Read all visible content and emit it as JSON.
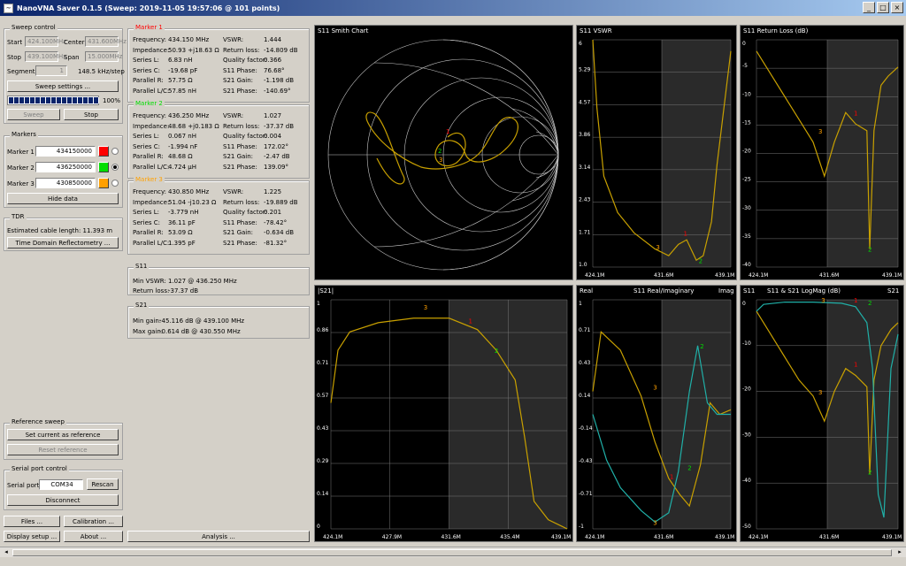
{
  "window": {
    "title": "NanoVNA Saver 0.1.5 (Sweep: 2019-11-05 19:57:06 @ 101 points)",
    "min": "_",
    "max": "□",
    "close": "×"
  },
  "sweep": {
    "title": "Sweep control",
    "start_label": "Start",
    "start_value": "424.100MHz",
    "center_label": "Center",
    "center_value": "431.600MHz",
    "stop_label": "Stop",
    "stop_value": "439.100MHz",
    "span_label": "Span",
    "span_value": "15.000MHz",
    "segments_label": "Segments",
    "segments_value": "1",
    "step_text": "148.5 kHz/step",
    "settings_btn": "Sweep settings ...",
    "progress_text": "100%",
    "progress": 1.0,
    "sweep_btn": "Sweep",
    "stop_btn": "Stop"
  },
  "markers": {
    "title": "Markers",
    "items": [
      {
        "label": "Marker 1",
        "value": "434150000",
        "color": "#ff0000"
      },
      {
        "label": "Marker 2",
        "value": "436250000",
        "color": "#00dd00"
      },
      {
        "label": "Marker 3",
        "value": "430850000",
        "color": "#ffa000"
      }
    ],
    "hide_btn": "Hide data"
  },
  "tdr": {
    "title": "TDR",
    "cable": "Estimated cable length: 11.393 m",
    "btn": "Time Domain Reflectometry ..."
  },
  "reference": {
    "title": "Reference sweep",
    "set_btn": "Set current as reference",
    "reset_btn": "Reset reference"
  },
  "serial": {
    "title": "Serial port control",
    "port_label": "Serial port",
    "port_value": "COM34",
    "rescan_btn": "Rescan",
    "disconnect_btn": "Disconnect"
  },
  "bottom": {
    "files": "Files ...",
    "calibration": "Calibration ...",
    "display": "Display setup ...",
    "about": "About ...",
    "analysis": "Analysis ..."
  },
  "m1": {
    "title": "Marker 1",
    "color": "#ff0000",
    "left": [
      [
        "Frequency:",
        "434.150 MHz"
      ],
      [
        "Impedance:",
        "50.93 +j18.63 Ω"
      ],
      [
        "Series L:",
        "6.83 nH"
      ],
      [
        "Series C:",
        "-19.68 pF"
      ],
      [
        "Parallel R:",
        "57.75 Ω"
      ],
      [
        "Parallel L/C:",
        "57.85 nH"
      ]
    ],
    "right": [
      [
        "VSWR:",
        "1.444"
      ],
      [
        "Return loss:",
        "-14.809 dB"
      ],
      [
        "Quality factor:",
        "0.366"
      ],
      [
        "S11 Phase:",
        "76.68°"
      ],
      [
        "S21 Gain:",
        "-1.198 dB"
      ],
      [
        "S21 Phase:",
        "-140.69°"
      ]
    ]
  },
  "m2": {
    "title": "Marker 2",
    "color": "#00dd00",
    "left": [
      [
        "Frequency:",
        "436.250 MHz"
      ],
      [
        "Impedance:",
        "48.68 +j0.183 Ω"
      ],
      [
        "Series L:",
        "0.067 nH"
      ],
      [
        "Series C:",
        "-1.994 nF"
      ],
      [
        "Parallel R:",
        "48.68 Ω"
      ],
      [
        "Parallel L/C:",
        "4.724 µH"
      ]
    ],
    "right": [
      [
        "VSWR:",
        "1.027"
      ],
      [
        "Return loss:",
        "-37.37 dB"
      ],
      [
        "Quality factor:",
        "0.004"
      ],
      [
        "S11 Phase:",
        "172.02°"
      ],
      [
        "S21 Gain:",
        "-2.47 dB"
      ],
      [
        "S21 Phase:",
        "139.09°"
      ]
    ]
  },
  "m3": {
    "title": "Marker 3",
    "color": "#ffa000",
    "left": [
      [
        "Frequency:",
        "430.850 MHz"
      ],
      [
        "Impedance:",
        "51.04 -j10.23 Ω"
      ],
      [
        "Series L:",
        "-3.779 nH"
      ],
      [
        "Series C:",
        "36.11 pF"
      ],
      [
        "Parallel R:",
        "53.09 Ω"
      ],
      [
        "Parallel L/C:",
        "1.395 pF"
      ]
    ],
    "right": [
      [
        "VSWR:",
        "1.225"
      ],
      [
        "Return loss:",
        "-19.889 dB"
      ],
      [
        "Quality factor:",
        "0.201"
      ],
      [
        "S11 Phase:",
        "-78.42°"
      ],
      [
        "S21 Gain:",
        "-0.634 dB"
      ],
      [
        "S21 Phase:",
        "-81.32°"
      ]
    ]
  },
  "s11box": {
    "title": "S11",
    "l1": "Min VSWR:",
    "v1": "1.027 @ 436.250 MHz",
    "l2": "Return loss:",
    "v2": "-37.37 dB"
  },
  "s21box": {
    "title": "S21",
    "l1": "Min gain:",
    "v1": "-45.116 dB @ 439.100 MHz",
    "l2": "Max gain:",
    "v2": "-0.614 dB @ 430.550 MHz"
  },
  "charts": {
    "smith": {
      "title": "S11 Smith Chart"
    },
    "vswr": {
      "title": "S11 VSWR",
      "yticks": [
        "6",
        "5.29",
        "4.57",
        "3.86",
        "3.14",
        "2.43",
        "1.71",
        "1.0"
      ],
      "xticks": [
        "424.1M",
        "431.6M",
        "439.1M"
      ]
    },
    "rl": {
      "title": "S11 Return Loss (dB)",
      "yticks": [
        "0",
        "-5",
        "-10",
        "-15",
        "-20",
        "-25",
        "-30",
        "-35",
        "-40"
      ],
      "xticks": [
        "424.1M",
        "431.6M",
        "439.1M"
      ]
    },
    "s21": {
      "title": "|S21|",
      "yticks": [
        "1",
        "0.86",
        "0.71",
        "0.57",
        "0.43",
        "0.29",
        "0.14",
        "0"
      ],
      "xticks": [
        "424.1M",
        "427.9M",
        "431.6M",
        "435.4M",
        "439.1M"
      ]
    },
    "ri": {
      "title": "S11 Real/Imaginary",
      "real": "Real",
      "imag": "Imag",
      "yticks": [
        "1",
        "0.71",
        "0.43",
        "0.14",
        "-0.14",
        "-0.43",
        "-0.71",
        "-1"
      ],
      "xticks": [
        "424.1M",
        "431.6M",
        "439.1M"
      ]
    },
    "lm": {
      "title": "S11 & S21 LogMag (dB)",
      "s11": "S11",
      "s21": "S21",
      "yticks": [
        "0",
        "-10",
        "-20",
        "-30",
        "-40",
        "-50"
      ],
      "xticks": [
        "424.1M",
        "431.6M",
        "439.1M"
      ]
    }
  }
}
